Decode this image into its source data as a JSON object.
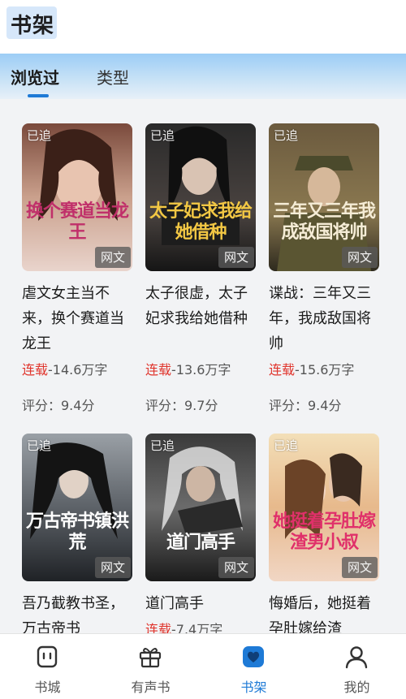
{
  "header": {
    "title": "书架"
  },
  "tabs": [
    {
      "label": "浏览过"
    },
    {
      "label": "类型"
    }
  ],
  "books": [
    {
      "title": "虐文女主当不来，换个赛道当龙王",
      "cover_text": "换个赛道当龙王",
      "badge": "已追",
      "tag": "网文",
      "status": "连载",
      "words": "-14.6万字",
      "score": "评分：9.4分"
    },
    {
      "title": "太子很虚，太子妃求我给她借种",
      "cover_text": "太子妃求我给她借种",
      "badge": "已追",
      "tag": "网文",
      "status": "连载",
      "words": "-13.6万字",
      "score": "评分：9.7分"
    },
    {
      "title": "谍战：三年又三年，我成敌国将帅",
      "cover_text": "三年又三年我成敌国将帅",
      "badge": "已追",
      "tag": "网文",
      "status": "连载",
      "words": "-15.6万字",
      "score": "评分：9.4分"
    },
    {
      "title": "吾乃截教书圣，万古帝书",
      "cover_text": "万古帝书镇洪荒",
      "badge": "已追",
      "tag": "网文",
      "status": "",
      "words": "",
      "score": ""
    },
    {
      "title": "道门高手",
      "cover_text": "道门高手",
      "badge": "已追",
      "tag": "网文",
      "status": "连载",
      "words": "-7.4万字",
      "score": ""
    },
    {
      "title": "悔婚后，她挺着孕肚嫁给渣",
      "cover_text": "她挺着孕肚嫁渣男小叔",
      "badge": "已追",
      "tag": "网文",
      "status": "",
      "words": "",
      "score": ""
    }
  ],
  "bottom_nav": [
    {
      "label": "书城",
      "icon": "bookstore-icon"
    },
    {
      "label": "有声书",
      "icon": "audiobook-gift-icon"
    },
    {
      "label": "书架",
      "icon": "bookshelf-heart-icon"
    },
    {
      "label": "我的",
      "icon": "profile-icon"
    }
  ],
  "colors": {
    "accent": "#1e7ad6",
    "status": "#e0342c"
  }
}
